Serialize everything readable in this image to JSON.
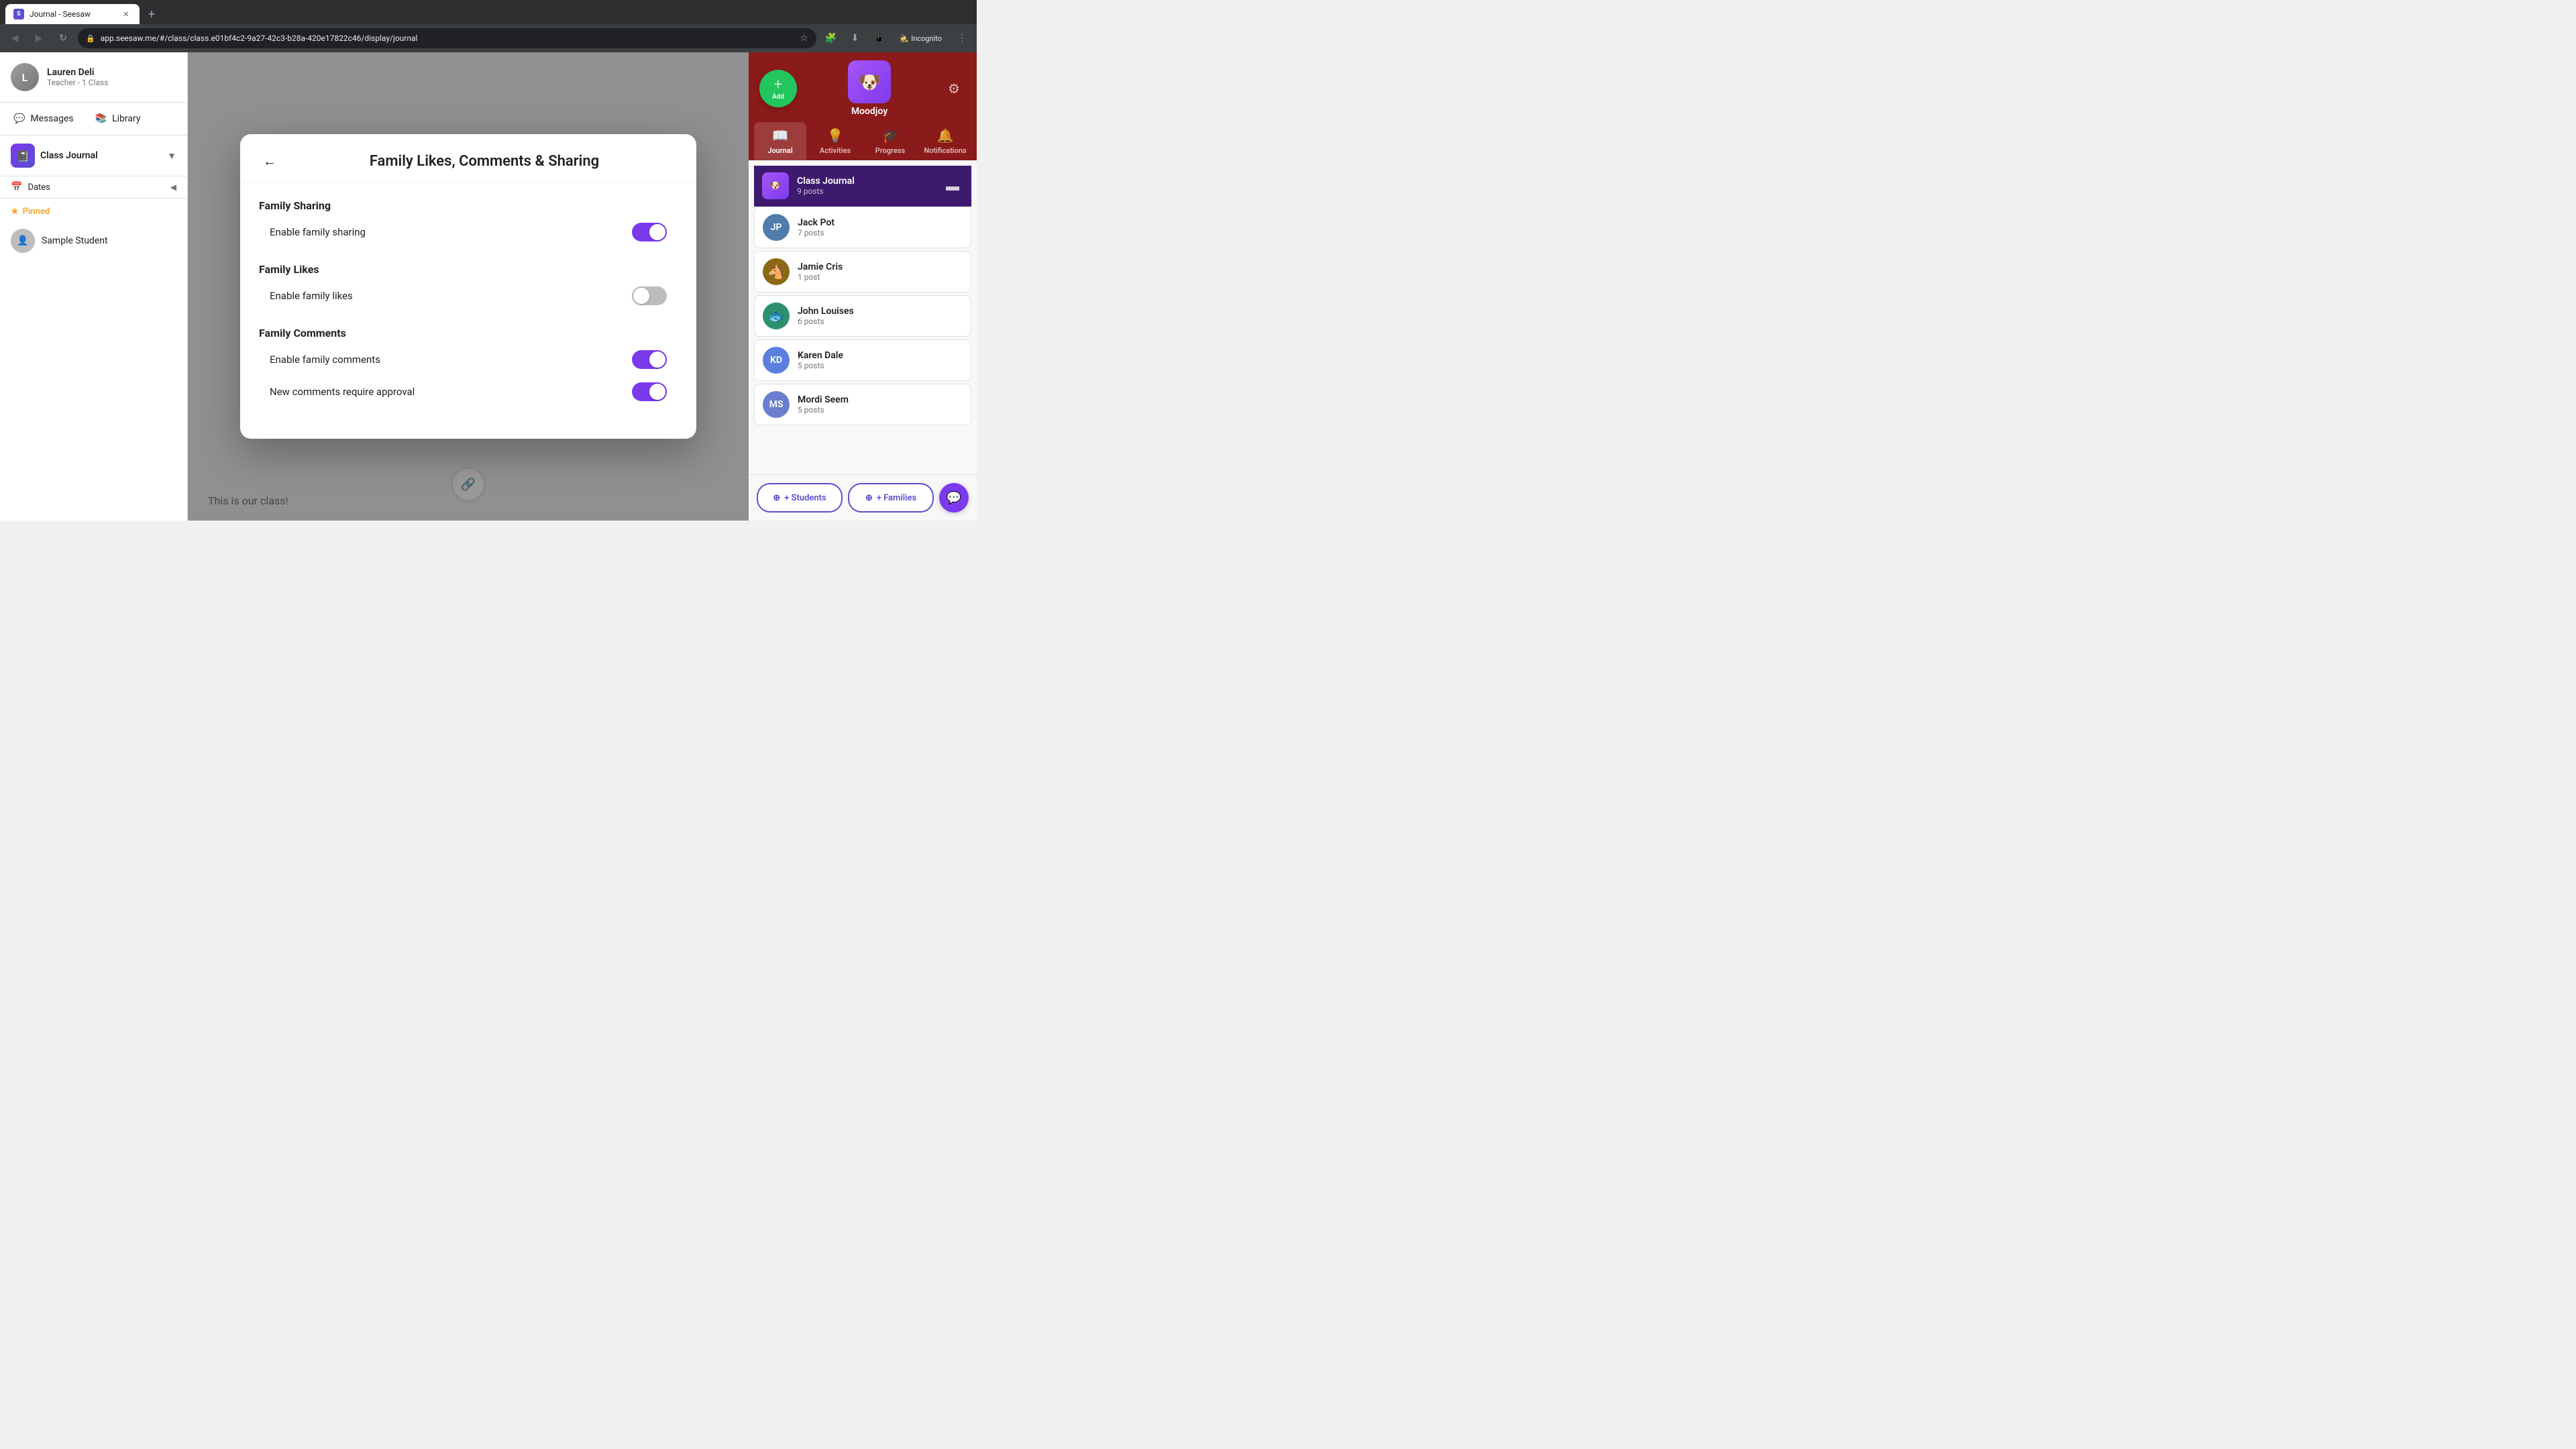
{
  "browser": {
    "tab_title": "Journal - Seesaw",
    "tab_favicon": "S",
    "address": "app.seesaw.me/#/class/class.e01bf4c2-9a27-42c3-b28a-420e17822c46/display/journal",
    "new_tab_label": "+"
  },
  "header": {
    "user_name": "Lauren Deli",
    "user_role": "Teacher - 1 Class",
    "messages_label": "Messages",
    "library_label": "Library",
    "add_label": "Add"
  },
  "sidebar": {
    "class_name": "Class Journal",
    "date_filter": "Dates",
    "pinned_label": "Pinned",
    "sample_student": "Sample Student"
  },
  "right_panel": {
    "moodjoy_label": "Moodjoy",
    "tabs": [
      {
        "id": "journal",
        "label": "Journal",
        "icon": "📖"
      },
      {
        "id": "activities",
        "label": "Activities",
        "icon": "💡"
      },
      {
        "id": "progress",
        "label": "Progress",
        "icon": "🎓"
      },
      {
        "id": "notifications",
        "label": "Notifications",
        "icon": "🔔"
      }
    ],
    "class_journal": {
      "name": "Class Journal",
      "posts": "9 posts"
    },
    "students": [
      {
        "id": "jp",
        "name": "Jack Pot",
        "posts": "7 posts",
        "initials": "JP",
        "color": "#4f7cac"
      },
      {
        "id": "jc",
        "name": "Jamie Cris",
        "posts": "1 post",
        "initials": "🐴",
        "color": "#8b6914",
        "is_animal": true
      },
      {
        "id": "jl",
        "name": "John Louises",
        "posts": "6 posts",
        "initials": "🐟",
        "color": "#2d8f6f",
        "is_animal": true
      },
      {
        "id": "kd",
        "name": "Karen Dale",
        "posts": "5 posts",
        "initials": "KD",
        "color": "#5b7fde"
      },
      {
        "id": "ms",
        "name": "Mordi Seem",
        "posts": "5 posts",
        "initials": "MS",
        "color": "#6b7fce"
      }
    ],
    "students_btn": "+ Students",
    "families_btn": "+ Families"
  },
  "modal": {
    "title": "Family Likes, Comments & Sharing",
    "back_label": "←",
    "sections": [
      {
        "id": "sharing",
        "title": "Family Sharing",
        "settings": [
          {
            "id": "enable_sharing",
            "label": "Enable family sharing",
            "state": "on"
          }
        ]
      },
      {
        "id": "likes",
        "title": "Family Likes",
        "settings": [
          {
            "id": "enable_likes",
            "label": "Enable family likes",
            "state": "off"
          }
        ]
      },
      {
        "id": "comments",
        "title": "Family Comments",
        "settings": [
          {
            "id": "enable_comments",
            "label": "Enable family comments",
            "state": "on"
          },
          {
            "id": "require_approval",
            "label": "New comments require approval",
            "state": "on"
          }
        ]
      }
    ]
  },
  "page": {
    "class_intro": "This is our class!"
  }
}
